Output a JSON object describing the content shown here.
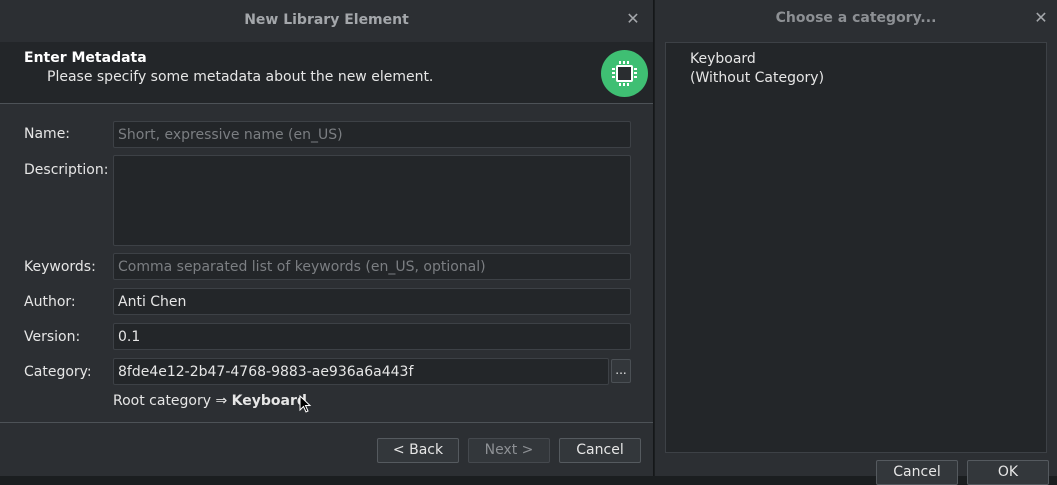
{
  "wizard": {
    "title": "New Library Element",
    "header": {
      "title": "Enter Metadata",
      "subtitle": "Please specify some metadata about the new element.",
      "logo_icon": "chip-icon",
      "logo_color": "#3fbf73"
    },
    "form": {
      "name": {
        "label": "Name:",
        "value": "",
        "placeholder": "Short, expressive name (en_US)"
      },
      "description": {
        "label": "Description:",
        "value": ""
      },
      "keywords": {
        "label": "Keywords:",
        "value": "",
        "placeholder": "Comma separated list of keywords (en_US, optional)"
      },
      "author": {
        "label": "Author:",
        "value": "Anti Chen"
      },
      "version": {
        "label": "Version:",
        "value": "0.1"
      },
      "category": {
        "label": "Category:",
        "value": "8fde4e12-2b47-4768-9883-ae936a6a443f",
        "browse_label": "..."
      },
      "root_category_prefix": "Root category ⇒ ",
      "root_category_name": "Keyboard"
    },
    "buttons": {
      "back": "< Back",
      "next": "Next >",
      "cancel": "Cancel"
    }
  },
  "category_chooser": {
    "title": "Choose a category...",
    "items": [
      "Keyboard",
      "(Without Category)"
    ],
    "buttons": {
      "cancel": "Cancel",
      "ok": "OK"
    }
  }
}
